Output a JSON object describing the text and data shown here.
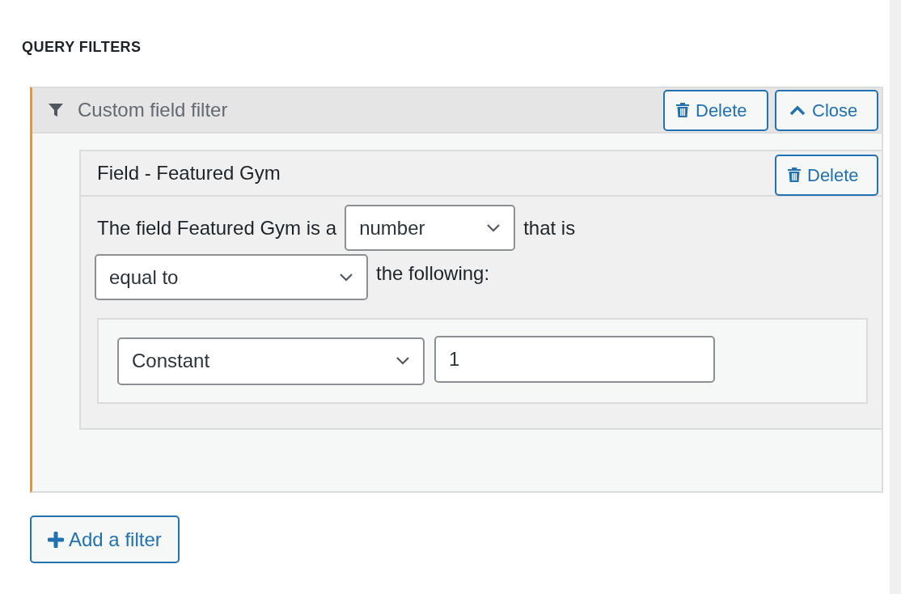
{
  "heading": "QUERY FILTERS",
  "filter": {
    "title": "Custom field filter",
    "expanded": true,
    "buttons": [
      {
        "kind": "delete",
        "label": "Delete"
      },
      {
        "kind": "close",
        "label": "Close"
      }
    ],
    "field": {
      "title": "Field - Featured Gym",
      "delete_label": "Delete",
      "sentence_start": "The field Featured Gym is a",
      "type_select": "number",
      "sentence_mid": "that is",
      "operator_select": "equal to",
      "sentence_end": "the following:",
      "value_source": "Constant",
      "value": "1"
    }
  },
  "add_button": "Add a filter"
}
